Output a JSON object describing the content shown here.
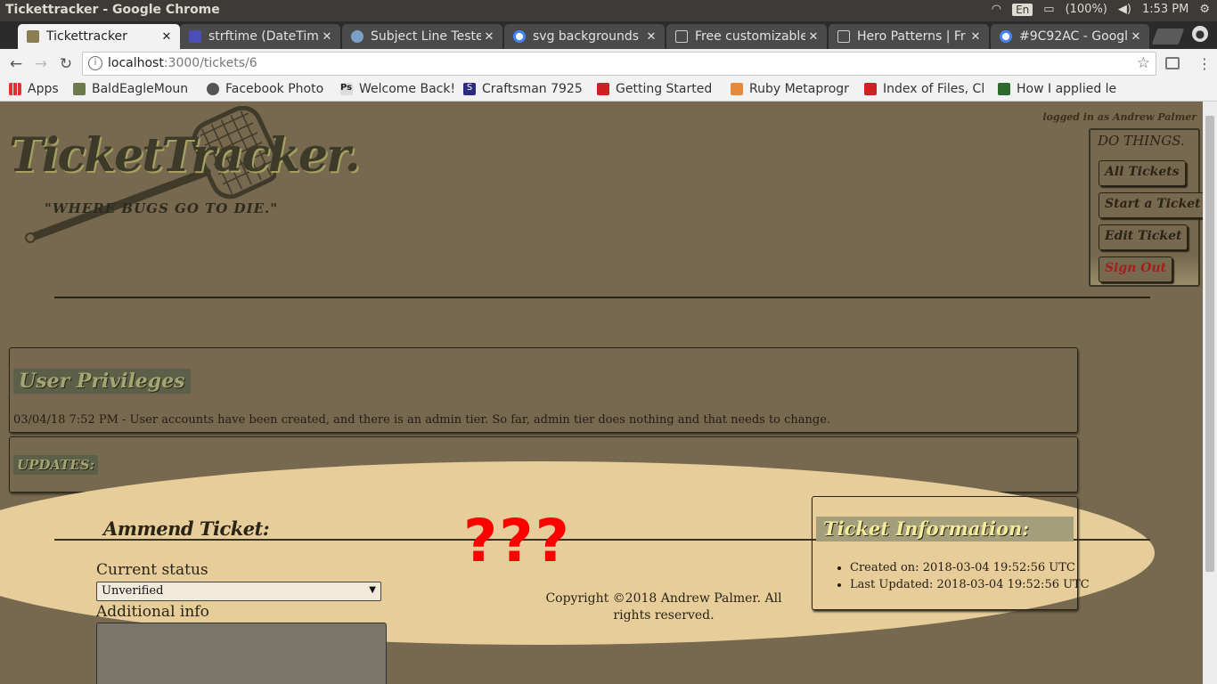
{
  "window": {
    "title": "Tickettracker - Google Chrome",
    "tray": {
      "lang": "En",
      "battery": "(100%)",
      "clock": "1:53 PM"
    }
  },
  "tabs": [
    {
      "label": "Tickettracker",
      "active": true
    },
    {
      "label": "strftime (DateTim",
      "active": false
    },
    {
      "label": "Subject Line Teste",
      "active": false
    },
    {
      "label": "svg backgrounds",
      "active": false
    },
    {
      "label": "Free customizable",
      "active": false
    },
    {
      "label": "Hero Patterns | Fr",
      "active": false
    },
    {
      "label": "#9C92AC - Google",
      "active": false
    }
  ],
  "omnibox": {
    "host": "localhost",
    "path": ":3000/tickets/6"
  },
  "bookmarks": [
    "Apps",
    "BaldEagleMoun",
    "Facebook Photo",
    "Welcome Back!",
    "Craftsman 7925",
    "Getting Started",
    "Ruby Metaprogr",
    "Index of Files, Cl",
    "How I applied le"
  ],
  "page": {
    "logged_in": "logged in as Andrew Palmer",
    "logo": "TicketTracker.",
    "tagline": "\"WHERE BUGS GO TO DIE.\"",
    "sidebar": {
      "title": "DO THINGS.",
      "buttons": [
        "All Tickets",
        "Start a Ticket",
        "Edit Ticket",
        "Sign Out"
      ]
    },
    "privileges": {
      "title": "User Privileges",
      "entry": "03/04/18 7:52 PM - User accounts have been created, and there is an admin tier. So far, admin tier does nothing and that needs to change."
    },
    "updates": {
      "title": "UPDATES:"
    },
    "ammend": {
      "title": "Ammend Ticket:",
      "status_label": "Current status",
      "status_value": "Unverified",
      "info_label": "Additional info"
    },
    "annotation": "???",
    "copyright": "Copyright ©2018 Andrew Palmer. All rights reserved.",
    "ticket_info": {
      "title": "Ticket Information:",
      "created": "Created on: 2018-03-04 19:52:56 UTC",
      "updated": "Last Updated: 2018-03-04 19:52:56 UTC"
    }
  },
  "colors": {
    "page_bg": "#77694f",
    "ellipse": "#e6cd9a",
    "annotation": "#ff0000",
    "sign_out": "#a3201c"
  }
}
